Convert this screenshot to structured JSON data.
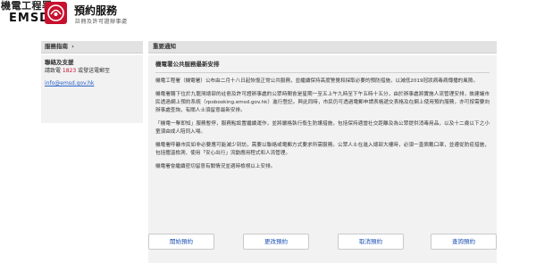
{
  "header": {
    "logo_cn": "機電工程署",
    "logo_en": "EMSD",
    "site_title": "預約服務",
    "site_subtitle": "註冊及許可證辦事處"
  },
  "sidebar": {
    "heading": "服務指南",
    "heading_arrow": "›",
    "contact_title": "聯絡及支援",
    "contact_prefix": "請致電 ",
    "contact_phone": "1823",
    "contact_suffix": " 或發送電郵至",
    "email": "info@emsd.gov.hk"
  },
  "main": {
    "heading": "重要通知",
    "notice_title": "機電署公共服務最新安排",
    "paragraphs": [
      "機電工程署（機電署）公布由二月十八日起恢復正常公共服務，並繼續保持高度警覺和採取必要的預防措施，以減低2019冠狀病毒病傳播的風險。",
      "機電署轄下位於九龍灣總部的註冊及許可證辦事處的公眾時間會是星期一至五上午九時至下午五時十五分，由於辦事處將實施人流管理安排，故建議市民透過網上預約系統（rpobooking.emsd.gov.hk）進行登記。與此同時，市民仍可透過電郵申請表格遞交表格及在網上使用預約服務，亦可按需要向辦事處查詢，有關人士須留意最新安排。",
      "「機電一擊即知」服務暫停，服務點設置繼續運作，並將嚴格執行衞生防護措施，包括保持適當社交距離及為公眾提供消毒用品，以及十二歲以下之小童須由成人陪同入場。",
      "機電署呼籲市民如非必要應可能減少到訪，需要以聯絡或電郵方式要求所需服務。公眾人士在進入總部大樓時，必須一直佩戴口罩，並遵從防疫措施，包括體溫檢測、使用「安心出行」流動應用程式和人流管理。",
      "機電署會繼續密切留意有關情況並適時檢視以上安排。"
    ]
  },
  "buttons": {
    "book": "開始預約",
    "change": "更改預約",
    "cancel": "取消預約",
    "query": "查詢預約"
  },
  "colors": {
    "brand_red": "#c8102e",
    "link_blue": "#2a62c9",
    "panel_bg": "#f2f2f2",
    "heading_bg": "#e2e2e2"
  }
}
